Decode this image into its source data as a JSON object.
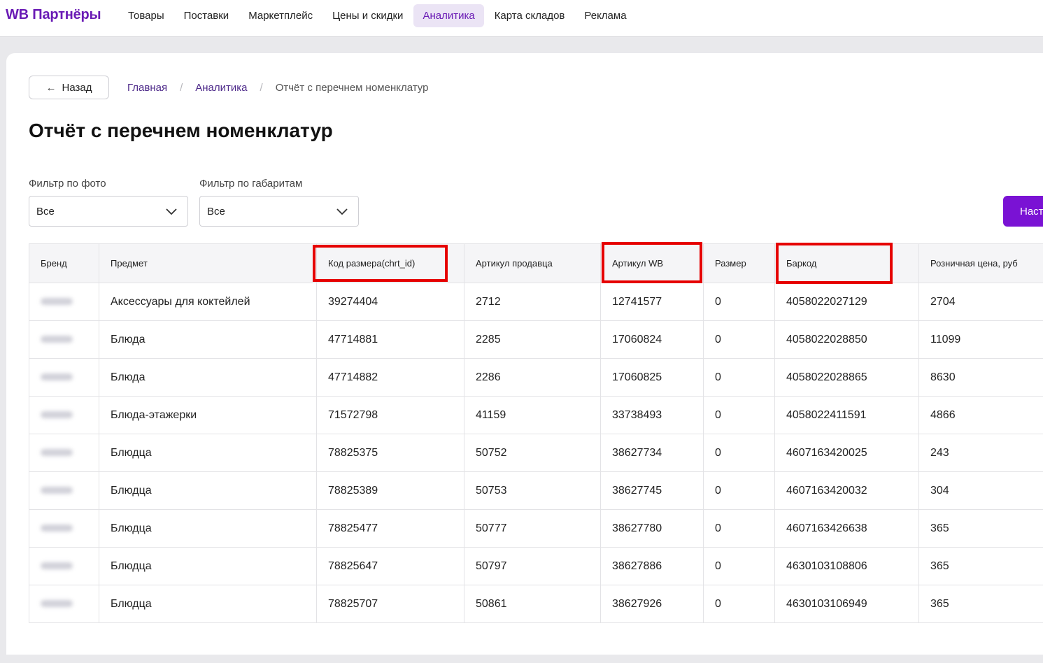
{
  "app": {
    "logo": "WB Партнёры"
  },
  "nav": [
    {
      "label": "Товары"
    },
    {
      "label": "Поставки"
    },
    {
      "label": "Маркетплейс"
    },
    {
      "label": "Цены и скидки"
    },
    {
      "label": "Аналитика",
      "active": true
    },
    {
      "label": "Карта складов"
    },
    {
      "label": "Реклама"
    }
  ],
  "back_button": {
    "label": "Назад",
    "icon": "arrow-left-icon"
  },
  "breadcrumb": {
    "items": [
      "Главная",
      "Аналитика"
    ],
    "current": "Отчёт с перечнем номенклатур",
    "separator": "/"
  },
  "page_title": "Отчёт с перечнем номенклатур",
  "filters": [
    {
      "label": "Фильтр по фото",
      "value": "Все"
    },
    {
      "label": "Фильтр по габаритам",
      "value": "Все"
    }
  ],
  "settings_button": {
    "label": "Наст"
  },
  "table": {
    "columns": [
      "Бренд",
      "Предмет",
      "Код размера(chrt_id)",
      "Артикул продавца",
      "Артикул WB",
      "Размер",
      "Баркод",
      "Розничная цена, руб"
    ],
    "highlighted_columns": [
      "Код размера(chrt_id)",
      "Артикул WB",
      "Баркод"
    ],
    "rows": [
      [
        "",
        "Аксессуары для коктейлей",
        "39274404",
        "2712",
        "12741577",
        "0",
        "4058022027129",
        "2704"
      ],
      [
        "",
        "Блюда",
        "47714881",
        "2285",
        "17060824",
        "0",
        "4058022028850",
        "11099"
      ],
      [
        "",
        "Блюда",
        "47714882",
        "2286",
        "17060825",
        "0",
        "4058022028865",
        "8630"
      ],
      [
        "",
        "Блюда-этажерки",
        "71572798",
        "41159",
        "33738493",
        "0",
        "4058022411591",
        "4866"
      ],
      [
        "",
        "Блюдца",
        "78825375",
        "50752",
        "38627734",
        "0",
        "4607163420025",
        "243"
      ],
      [
        "",
        "Блюдца",
        "78825389",
        "50753",
        "38627745",
        "0",
        "4607163420032",
        "304"
      ],
      [
        "",
        "Блюдца",
        "78825477",
        "50777",
        "38627780",
        "0",
        "4607163426638",
        "365"
      ],
      [
        "",
        "Блюдца",
        "78825647",
        "50797",
        "38627886",
        "0",
        "4630103108806",
        "365"
      ],
      [
        "",
        "Блюдца",
        "78825707",
        "50861",
        "38627926",
        "0",
        "4630103106949",
        "365"
      ]
    ]
  },
  "colors": {
    "brand": "#6a1bb5",
    "primary_button": "#7a12d4",
    "highlight": "#e60000"
  }
}
